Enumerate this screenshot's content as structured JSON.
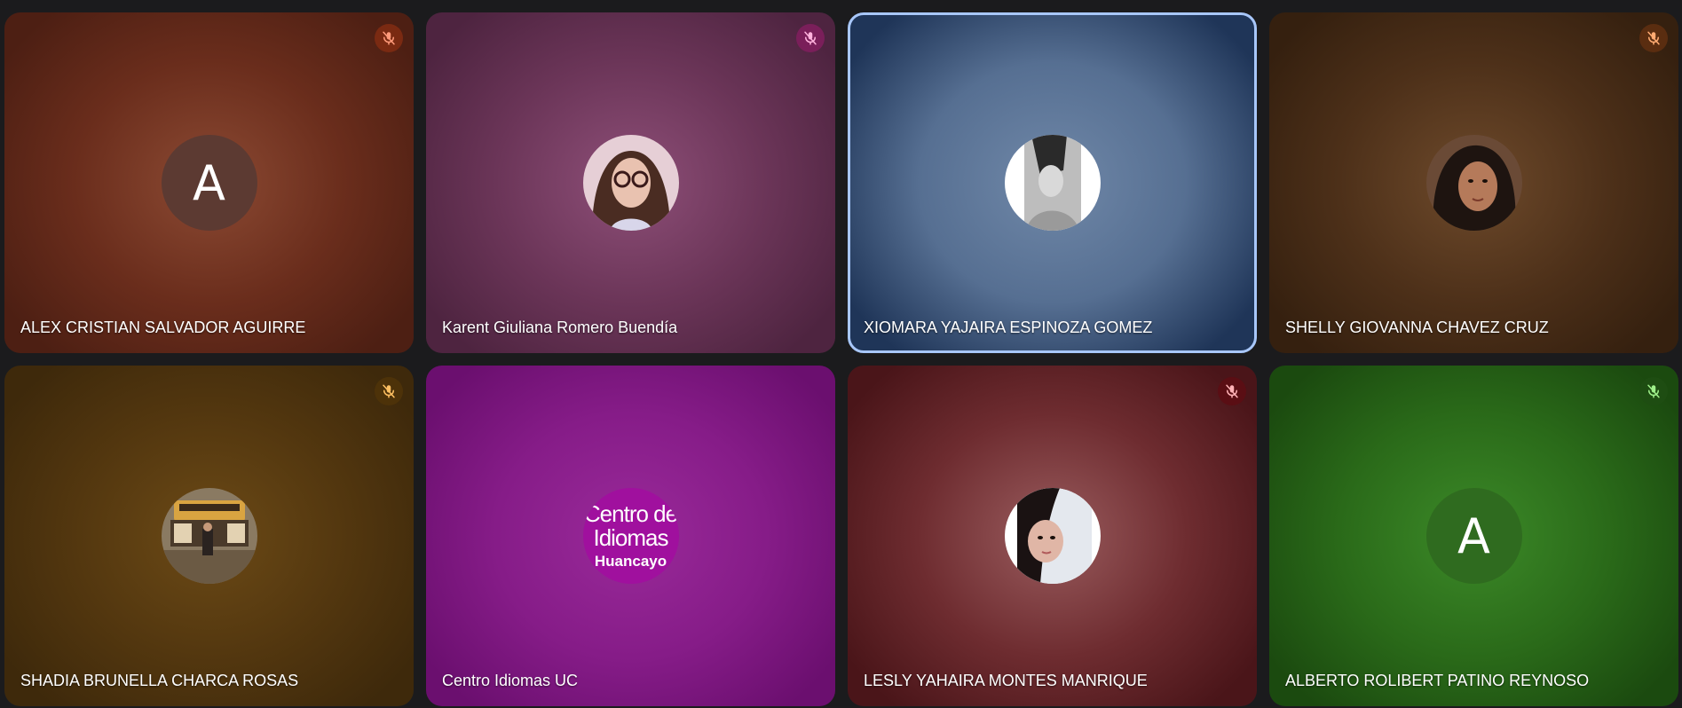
{
  "participants": [
    {
      "name": "ALEX CRISTIAN SALVADOR AGUIRRE",
      "avatar_type": "letter",
      "avatar_letter": "A",
      "avatar_color": "#5c3a32",
      "tile_colors": [
        "#8c4a33",
        "#6a2d1c",
        "#4d1f13"
      ],
      "muted": true,
      "mute_badge_color": "#7a2a12",
      "mute_icon_color": "#ff9a7a",
      "active": false
    },
    {
      "name": "Karent Giuliana Romero Buendía",
      "avatar_type": "photo",
      "avatar_icon": "woman-with-glasses-photo",
      "tile_colors": [
        "#8e4f78",
        "#6b3558",
        "#4e2440"
      ],
      "muted": true,
      "mute_badge_color": "#7a1f5a",
      "mute_icon_color": "#ffb2dd",
      "active": false
    },
    {
      "name": "XIOMARA YAJAIRA ESPINOZA GOMEZ",
      "avatar_type": "photo",
      "avatar_icon": "grayscale-portrait-photo",
      "tile_colors": [
        "#7088a8",
        "#566f92",
        "#1f3558"
      ],
      "muted": false,
      "active": true
    },
    {
      "name": "SHELLY GIOVANNA CHAVEZ CRUZ",
      "avatar_type": "photo",
      "avatar_icon": "woman-portrait-photo",
      "tile_colors": [
        "#6e4a2b",
        "#4d3019",
        "#35200f"
      ],
      "muted": true,
      "mute_badge_color": "#5a2d10",
      "mute_icon_color": "#ffab72",
      "active": false
    },
    {
      "name": "SHADIA BRUNELLA CHARCA ROSAS",
      "avatar_type": "photo",
      "avatar_icon": "excavator-photo",
      "tile_colors": [
        "#6c4a16",
        "#53370f",
        "#3e290b"
      ],
      "muted": true,
      "mute_badge_color": "#4d3209",
      "mute_icon_color": "#ffc062",
      "active": false
    },
    {
      "name": "Centro Idiomas UC",
      "avatar_type": "logo",
      "avatar_color": "#a0109e",
      "logo_lines": [
        "Centro de",
        "Idiomas",
        "Huancayo"
      ],
      "tile_colors": [
        "#9a2a9a",
        "#861c88",
        "#6b0f6f"
      ],
      "muted": false,
      "active": false
    },
    {
      "name": "LESLY YAHAIRA MONTES MANRIQUE",
      "avatar_type": "photo",
      "avatar_icon": "woman-selfie-photo",
      "tile_colors": [
        "#9a5c5e",
        "#6e2c30",
        "#4a1519"
      ],
      "muted": true,
      "mute_badge_color": "#5a0e14",
      "mute_icon_color": "#ffb2b6",
      "active": false
    },
    {
      "name": "ALBERTO ROLIBERT PATINO REYNOSO",
      "avatar_type": "letter",
      "avatar_letter": "A",
      "avatar_color": "#2f6b1f",
      "tile_colors": [
        "#3c8a28",
        "#2a6a19",
        "#1b4a0f"
      ],
      "muted": true,
      "mute_badge_color": "#1e4d12",
      "mute_icon_color": "#9ff08a",
      "active": false
    }
  ]
}
